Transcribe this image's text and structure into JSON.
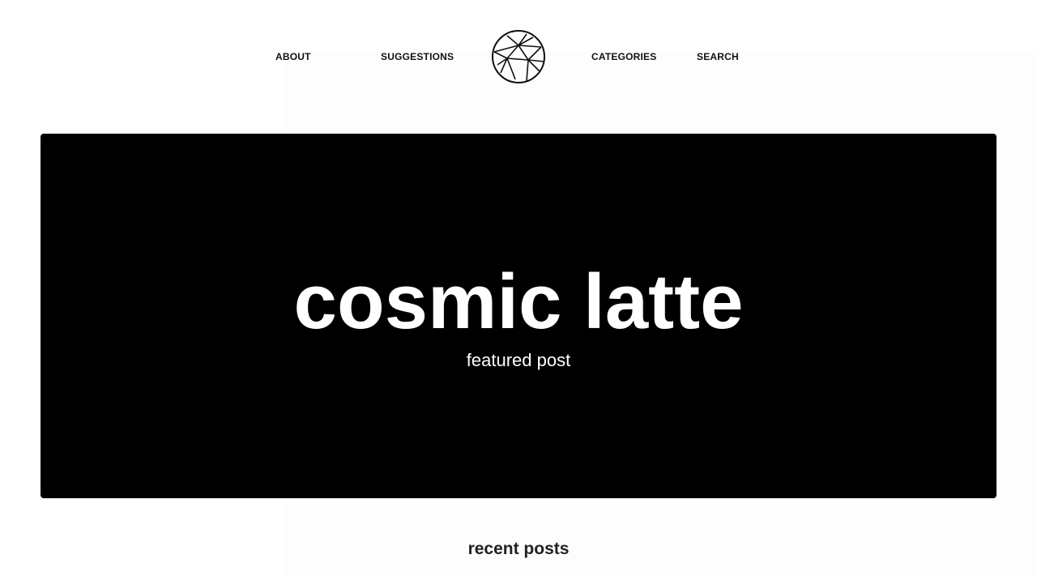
{
  "nav": {
    "about_label": "ABOUT",
    "suggestions_label": "SUGGESTIONS",
    "categories_label": "CATEGORIES",
    "search_label": "SEARCH",
    "logo_icon": "geometric-circle-logo-icon"
  },
  "hero": {
    "title": "cosmic latte",
    "subtitle": "featured post",
    "background_color": "#000000",
    "text_color": "#ffffff"
  },
  "recent": {
    "heading": "recent posts"
  }
}
